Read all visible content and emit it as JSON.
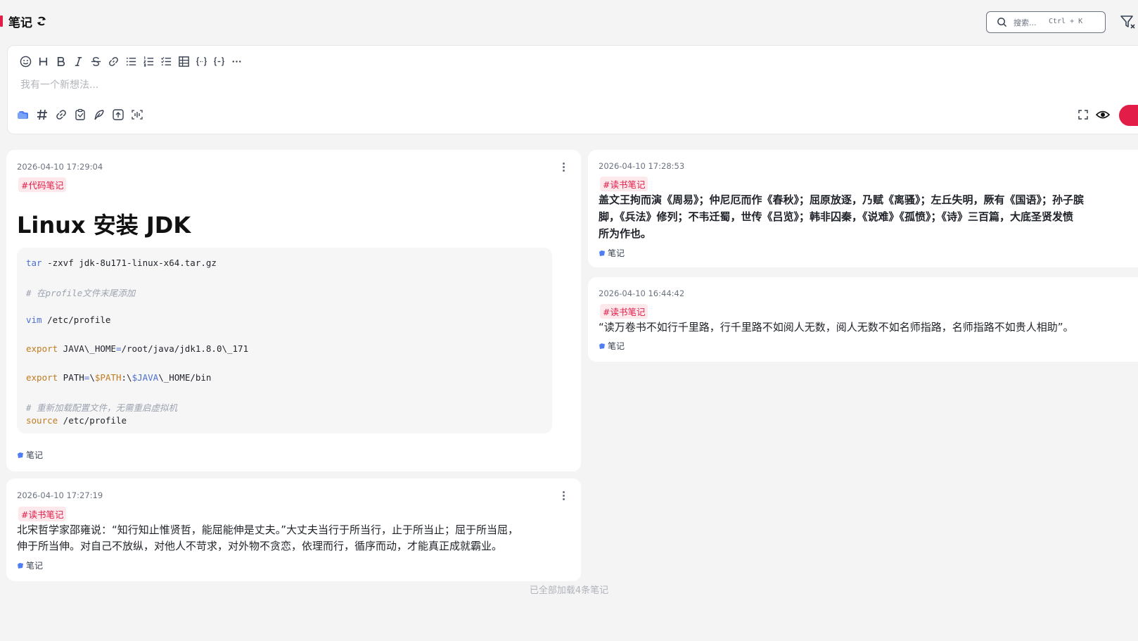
{
  "header": {
    "title": "笔记",
    "search_placeholder": "搜索...",
    "search_shortcut": "Ctrl + K"
  },
  "editor": {
    "placeholder": "我有一个新想法..."
  },
  "notes": [
    {
      "timestamp": "2026-04-10 17:29:04",
      "tag": "#代码笔记",
      "heading": "Linux 安装 JDK",
      "code": {
        "l1_cmd": "tar",
        "l1_rest": " -zxvf jdk-8u171-linux-x64.tar.gz",
        "l2_comment": "# 在profile文件末尾添加",
        "l3_cmd": "vim",
        "l3_rest": " /etc/profile",
        "l4_kw": "export",
        "l4_a": " JAVA\\_HOME",
        "l4_eq": "=",
        "l4_b": "/root/java/jdk1.8.0\\_171",
        "l5_kw": "export",
        "l5_a": " PATH",
        "l5_eq": "=",
        "l5_b": "\\",
        "l5_var1": "$PATH",
        "l5_c": ":\\",
        "l5_var2": "$JAVA",
        "l5_d": "\\_HOME/bin",
        "l6_comment": "# 重新加载配置文件，无需重启虚拟机",
        "l7_kw": "source",
        "l7_rest": " /etc/profile"
      },
      "footer": "笔记"
    },
    {
      "timestamp": "2026-04-10 17:27:19",
      "tag": "#读书笔记",
      "text_line1": "北宋哲学家邵雍说：“知行知止惟贤哲，能屈能伸是丈夫。”大丈夫当行于所当行，止于所当止；屈于所当屈，",
      "text_line2": "伸于所当伸。对自己不放纵，对他人不苛求，对外物不贪恋，依理而行，循序而动，才能真正成就霸业。",
      "footer": "笔记"
    },
    {
      "timestamp": "2026-04-10 17:28:53",
      "tag": "#读书笔记",
      "text_line1": "盖文王拘而演《周易》；仲尼厄而作《春秋》；屈原放逐，乃赋《离骚》；左丘失明，厥有《国语》；孙子膑",
      "text_line2": "脚，《兵法》修列；不韦迁蜀，世传《吕览》；韩非囚秦，《说难》《孤愤》；《诗》三百篇，大底圣贤发愤",
      "text_line3": "所为作也。",
      "footer": "笔记"
    },
    {
      "timestamp": "2026-04-10 16:44:42",
      "tag": "#读书笔记",
      "text_line1": "“读万卷书不如行千里路，行千里路不如阅人无数，阅人无数不如名师指路，名师指路不如贵人相助”。",
      "footer": "笔记"
    }
  ],
  "status": {
    "loaded_text": "已全部加载4条笔记"
  },
  "colors": {
    "accent": "#e11d48",
    "tag_bg": "#fde8ec",
    "background": "#f4f4f5",
    "folder_icon": "#4f7df3"
  }
}
